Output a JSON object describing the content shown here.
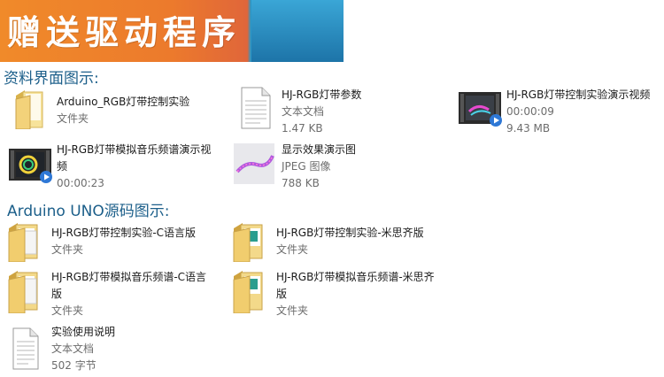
{
  "banner": {
    "title": "赠送驱动程序"
  },
  "section1": {
    "label": "资料界面图示:",
    "items": [
      {
        "name": "Arduino_RGB灯带控制实验",
        "line2": "文件夹",
        "line3": "",
        "icon": "folder-icon"
      },
      {
        "name": "HJ-RGB灯带参数",
        "line2": "文本文档",
        "line3": "1.47 KB",
        "icon": "text-document-icon"
      },
      {
        "name": "HJ-RGB灯带控制实验演示视频",
        "line2": "00:00:09",
        "line3": "9.43 MB",
        "icon": "video-thumbnail-icon"
      },
      {
        "name": "HJ-RGB灯带模拟音乐频谱演示视",
        "name2": "频",
        "line2": "00:00:23",
        "line3": "",
        "icon": "video-thumbnail-icon"
      },
      {
        "name": "显示效果演示图",
        "line2": "JPEG 图像",
        "line3": "788 KB",
        "icon": "image-thumbnail-icon"
      }
    ]
  },
  "section2": {
    "label": "Arduino UNO源码图示:",
    "items": [
      {
        "name": "HJ-RGB灯带控制实验-C语言版",
        "line2": "文件夹",
        "icon": "folder-stack-icon"
      },
      {
        "name": "HJ-RGB灯带控制实验-米思齐版",
        "line2": "文件夹",
        "icon": "folder-mixly-icon"
      },
      {
        "name": "HJ-RGB灯带模拟音乐频谱-C语言",
        "name2": "版",
        "line2": "文件夹",
        "icon": "folder-stack-icon"
      },
      {
        "name": "HJ-RGB灯带模拟音乐频谱-米思齐",
        "name2": "版",
        "line2": "文件夹",
        "icon": "folder-mixly-icon"
      },
      {
        "name": "实验使用说明",
        "line2": "文本文档",
        "line3": "502 字节",
        "icon": "text-document-icon"
      }
    ]
  },
  "colors": {
    "banner_orange": "#ec7a2c",
    "banner_blue": "#1f7fb3",
    "section_label": "#1c5f8a"
  }
}
